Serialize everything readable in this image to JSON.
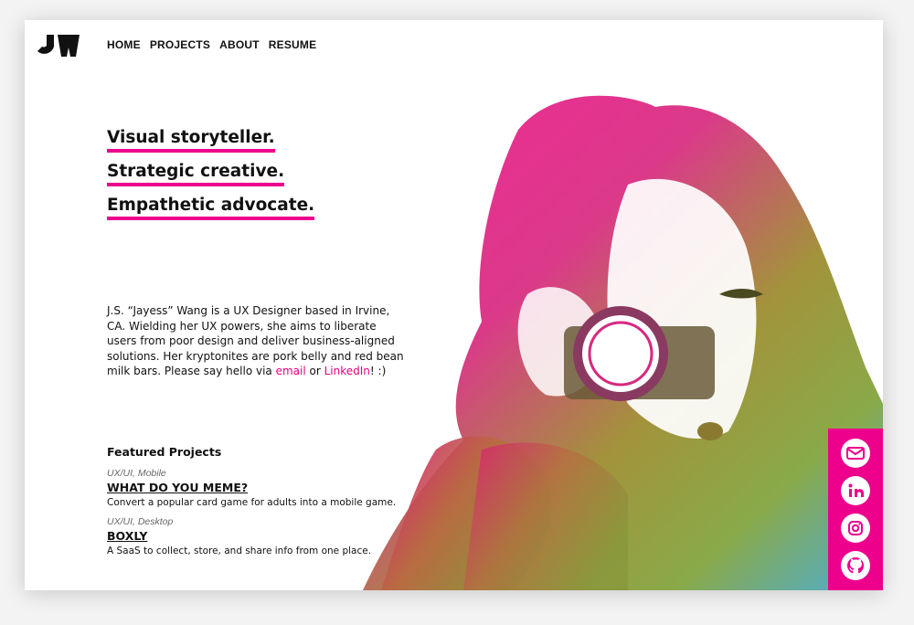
{
  "logo": {
    "text": "JW"
  },
  "nav": {
    "items": [
      "HOME",
      "PROJECTS",
      "ABOUT",
      "RESUME"
    ]
  },
  "headlines": [
    "Visual storyteller.",
    "Strategic creative.",
    "Empathetic advocate."
  ],
  "bio": {
    "text": "J.S. “Jayess” Wang is a UX Designer based in Irvine, CA. Wielding her UX powers, she aims to liberate users from poor design and deliver business-aligned solutions. Her kryptonites are pork belly and red bean milk bars. Please say hello via ",
    "email_label": "email",
    "or_text": " or ",
    "linkedin_label": "LinkedIn",
    "end_text": "! :)"
  },
  "featured": {
    "heading": "Featured Projects",
    "projects": [
      {
        "category": "UX/UI, Mobile",
        "title": "WHAT DO YOU MEME?",
        "description": "Convert a popular card game for adults into a mobile game."
      },
      {
        "category": "UX/UI, Desktop",
        "title": "BOXLY",
        "description": "A SaaS to collect, store, and share info from one place."
      }
    ]
  },
  "social": {
    "icons": [
      "email-icon",
      "linkedin-icon",
      "instagram-icon",
      "github-icon"
    ]
  },
  "colors": {
    "accent": "#ec008c",
    "text": "#111111",
    "gradient": [
      "#f0168c",
      "#c8307a",
      "#9a8a2a",
      "#7fa23a",
      "#3aa6d8"
    ]
  }
}
